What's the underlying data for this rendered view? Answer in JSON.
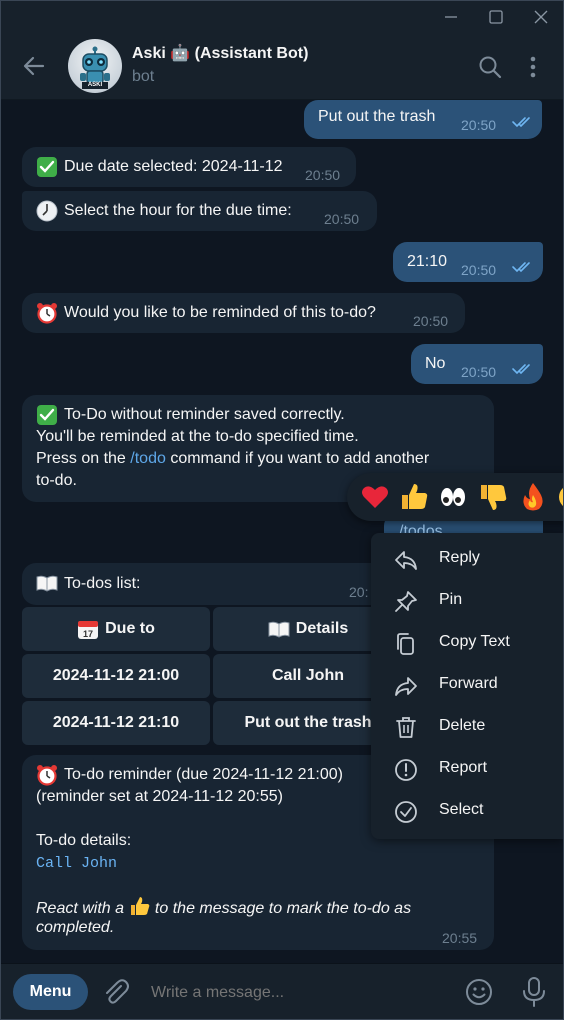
{
  "header": {
    "chat_name": "Aski 🤖 (Assistant Bot)",
    "status": "bot",
    "avatar_label": "ASKI"
  },
  "messages": {
    "m1": {
      "text": "Put out the trash",
      "time": "20:50"
    },
    "m2": {
      "text": "Due date selected: 2024-11-12",
      "time": "20:50"
    },
    "m3": {
      "text": "Select the hour for the due time:",
      "time": "20:50"
    },
    "m4": {
      "text": "21:10",
      "time": "20:50"
    },
    "m5": {
      "text": "Would you like to be reminded of this to-do?",
      "time": "20:50"
    },
    "m6": {
      "text": "No",
      "time": "20:50"
    },
    "m7": {
      "line1": "To-Do without reminder saved correctly.",
      "line2": "You'll be reminded at the to-do specified time.",
      "line3_pre": "Press on the ",
      "line3_link": "/todo",
      "line3_post": " command if you want to add another",
      "line4": "to-do."
    },
    "m8": {
      "text": "/todos"
    },
    "m9": {
      "text": "To-dos list:",
      "time": "20:"
    },
    "m10": {
      "line1": "To-do reminder (due 2024-11-12 21:00)",
      "line2": "(reminder set at 2024-11-12 20:55)",
      "details_label": "To-do details:",
      "details_value": "Call John",
      "react_pre": "React with a ",
      "react_post": " to the message to mark the to-do as",
      "react_end": "completed.",
      "time": "20:55"
    }
  },
  "keyboard": {
    "header_due": "Due to",
    "header_details": "Details",
    "rows": [
      {
        "due": "2024-11-12 21:00",
        "details": "Call John"
      },
      {
        "due": "2024-11-12 21:10",
        "details": "Put out the trash"
      }
    ]
  },
  "context_menu": {
    "items": [
      "Reply",
      "Pin",
      "Copy Text",
      "Forward",
      "Delete",
      "Report",
      "Select"
    ]
  },
  "reactions": [
    "heart",
    "thumbs-up",
    "eyes",
    "thumbs-down",
    "fire"
  ],
  "composer": {
    "menu_label": "Menu",
    "placeholder": "Write a message..."
  },
  "colors": {
    "background": "#0e1621",
    "panel": "#17212b",
    "incoming_bubble": "#182533",
    "outgoing_bubble": "#2b5278",
    "accent": "#5ea7e8",
    "menu_button": "#2b5278"
  }
}
